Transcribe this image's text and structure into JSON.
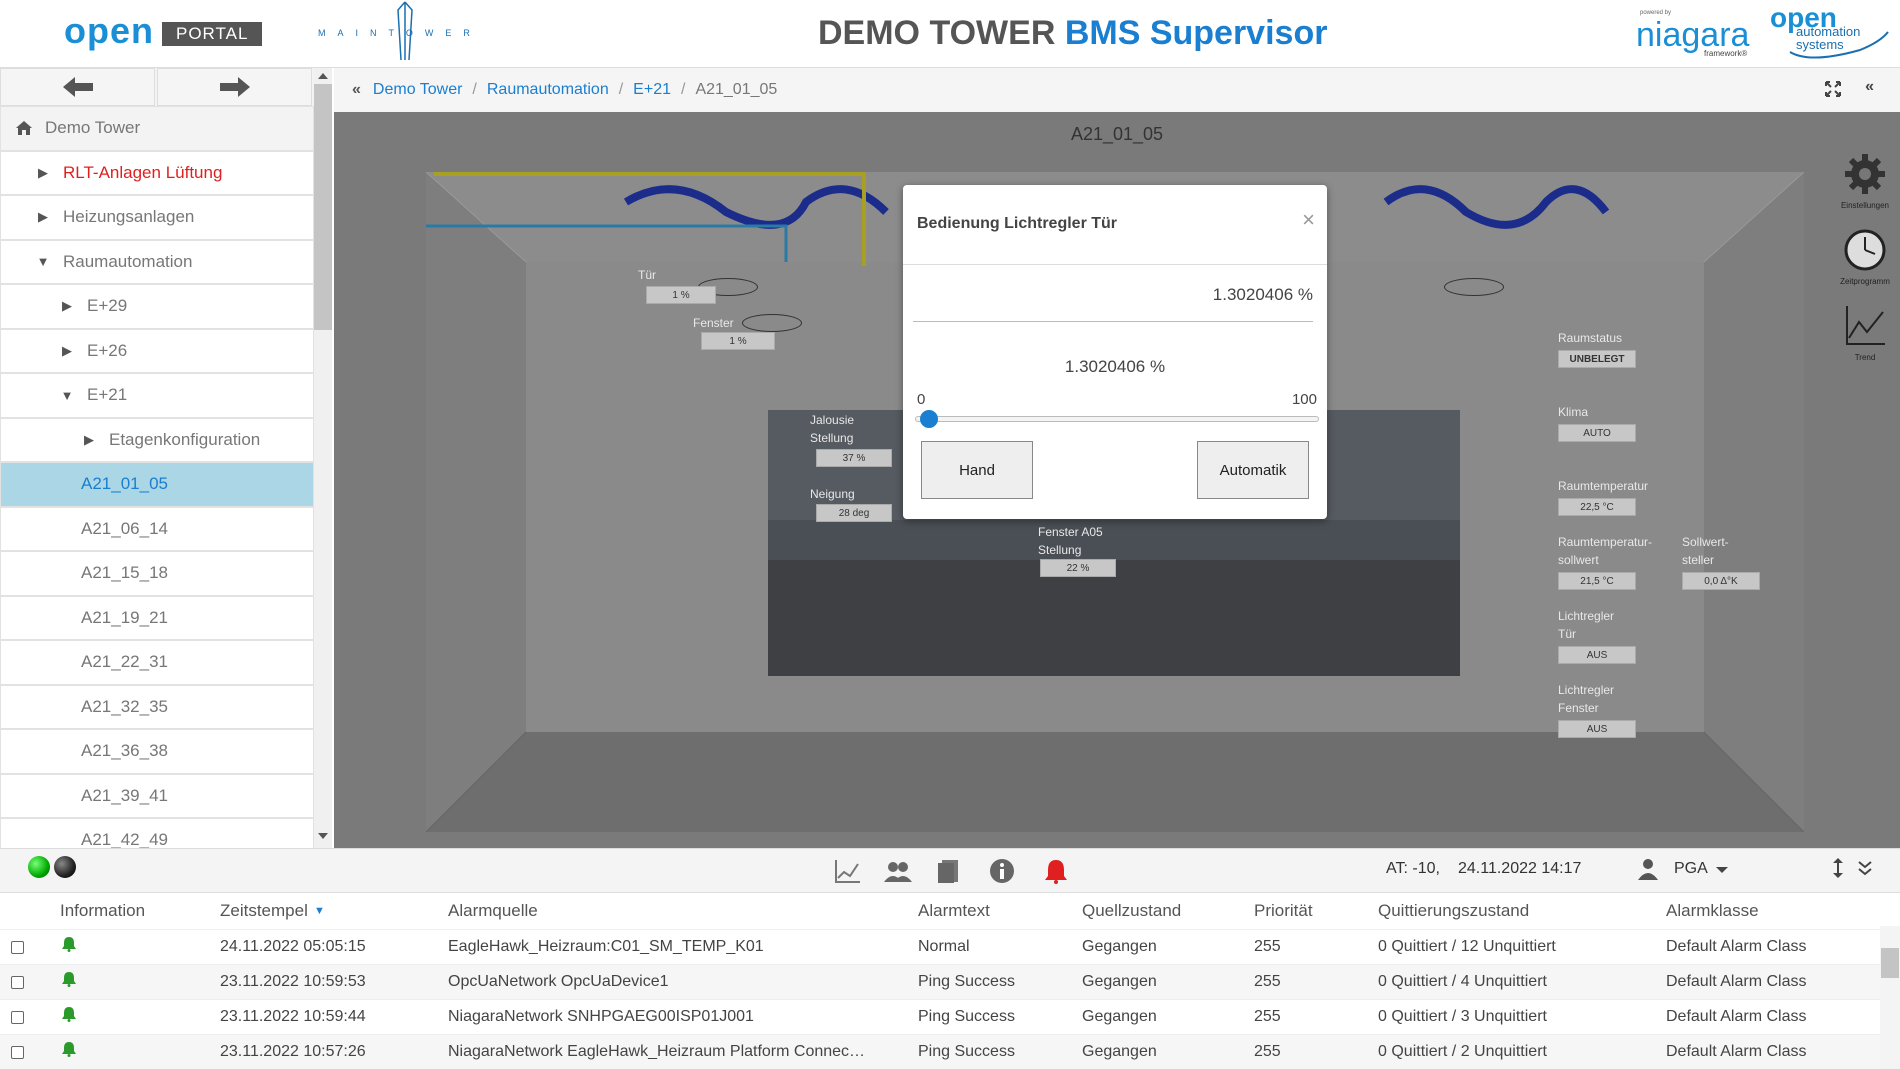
{
  "header": {
    "logo_open": "open",
    "logo_portal": "PORTAL",
    "logo_maintower": "MAINTOWER",
    "title_main": "DEMO TOWER",
    "title_accent": "BMS Supervisor",
    "niagara_powered": "powered by",
    "niagara": "niagara",
    "niagara_framework": "framework®",
    "oas_line1": "open",
    "oas_line2": "automation",
    "oas_line3": "systems"
  },
  "sidebar": {
    "root": "Demo Tower",
    "items": [
      {
        "label": "RLT-Anlagen Lüftung",
        "arrow": "▶",
        "indent": 0,
        "style": "red"
      },
      {
        "label": "Heizungsanlagen",
        "arrow": "▶",
        "indent": 0,
        "style": ""
      },
      {
        "label": "Raumautomation",
        "arrow": "▼",
        "indent": 0,
        "style": ""
      },
      {
        "label": "E+29",
        "arrow": "▶",
        "indent": 1,
        "style": ""
      },
      {
        "label": "E+26",
        "arrow": "▶",
        "indent": 1,
        "style": ""
      },
      {
        "label": "E+21",
        "arrow": "▼",
        "indent": 1,
        "style": ""
      },
      {
        "label": "Etagenkonfiguration",
        "arrow": "▶",
        "indent": 2,
        "style": ""
      },
      {
        "label": "A21_01_05",
        "arrow": "",
        "indent": 2,
        "style": "sel"
      },
      {
        "label": "A21_06_14",
        "arrow": "",
        "indent": 2,
        "style": ""
      },
      {
        "label": "A21_15_18",
        "arrow": "",
        "indent": 2,
        "style": ""
      },
      {
        "label": "A21_19_21",
        "arrow": "",
        "indent": 2,
        "style": ""
      },
      {
        "label": "A21_22_31",
        "arrow": "",
        "indent": 2,
        "style": ""
      },
      {
        "label": "A21_32_35",
        "arrow": "",
        "indent": 2,
        "style": ""
      },
      {
        "label": "A21_36_38",
        "arrow": "",
        "indent": 2,
        "style": ""
      },
      {
        "label": "A21_39_41",
        "arrow": "",
        "indent": 2,
        "style": ""
      },
      {
        "label": "A21_42_49",
        "arrow": "",
        "indent": 2,
        "style": ""
      }
    ]
  },
  "breadcrumb": {
    "items": [
      "Demo Tower",
      "Raumautomation",
      "E+21"
    ],
    "current": "A21_01_05"
  },
  "room": {
    "title": "A21_01_05",
    "tuer_label": "Tür",
    "tuer_value": "1 %",
    "fenster_label": "Fenster",
    "fenster_value": "1 %",
    "jalousie_label1": "Jalousie",
    "jalousie_label2": "Stellung",
    "jalousie_value": "37 %",
    "neigung_label": "Neigung",
    "neigung_value": "28 deg",
    "fenster_a05_label1": "Fenster A05",
    "fenster_a05_label2": "Stellung",
    "fenster_a05_value": "22 %",
    "raumstatus_label": "Raumstatus",
    "raumstatus_value": "UNBELEGT",
    "klima_label": "Klima",
    "klima_value": "AUTO",
    "raumtemp_label": "Raumtemperatur",
    "raumtemp_value": "22,5 °C",
    "raumtemp_soll_label1": "Raumtemperatur-",
    "raumtemp_soll_label2": "sollwert",
    "raumtemp_soll_value": "21,5 °C",
    "sollwertsteller_label1": "Sollwert-",
    "sollwertsteller_label2": "steller",
    "sollwertsteller_value": "0,0 Δ°K",
    "lichtregler_tuer_label1": "Lichtregler",
    "lichtregler_tuer_label2": "Tür",
    "lichtregler_tuer_value": "AUS",
    "lichtregler_fenster_label1": "Lichtregler",
    "lichtregler_fenster_label2": "Fenster",
    "lichtregler_fenster_value": "AUS"
  },
  "side_icons": {
    "settings": "Einstellungen",
    "schedule": "Zeitprogramm",
    "trend": "Trend"
  },
  "modal": {
    "title": "Bedienung Lichtregler Tür",
    "value_display": "1.3020406 %",
    "value_center": "1.3020406 %",
    "slider_min": "0",
    "slider_max": "100",
    "slider_value_percent": 1.3,
    "btn_hand": "Hand",
    "btn_auto": "Automatik"
  },
  "statusbar": {
    "at_text": "AT: -10,",
    "datetime": "24.11.2022 14:17",
    "user": "PGA"
  },
  "alarms": {
    "columns": [
      "Information",
      "Zeitstempel",
      "Alarmquelle",
      "Alarmtext",
      "Quellzustand",
      "Priorität",
      "Quittierungszustand",
      "Alarmklasse"
    ],
    "rows": [
      [
        "24.11.2022 05:05:15",
        "EagleHawk_Heizraum:C01_SM_TEMP_K01",
        "Normal",
        "Gegangen",
        "255",
        "0 Quittiert / 12 Unquittiert",
        "Default Alarm Class"
      ],
      [
        "23.11.2022 10:59:53",
        "OpcUaNetwork OpcUaDevice1",
        "Ping Success",
        "Gegangen",
        "255",
        "0 Quittiert / 4 Unquittiert",
        "Default Alarm Class"
      ],
      [
        "23.11.2022 10:59:44",
        "NiagaraNetwork SNHPGAEG00ISP01J001",
        "Ping Success",
        "Gegangen",
        "255",
        "0 Quittiert / 3 Unquittiert",
        "Default Alarm Class"
      ],
      [
        "23.11.2022 10:57:26",
        "NiagaraNetwork EagleHawk_Heizraum Platform Connec…",
        "Ping Success",
        "Gegangen",
        "255",
        "0 Quittiert / 2 Unquittiert",
        "Default Alarm Class"
      ]
    ]
  },
  "colors": {
    "accent": "#1a7fd0",
    "alarm_red": "#e02020",
    "selected_bg": "#aad6e6"
  }
}
